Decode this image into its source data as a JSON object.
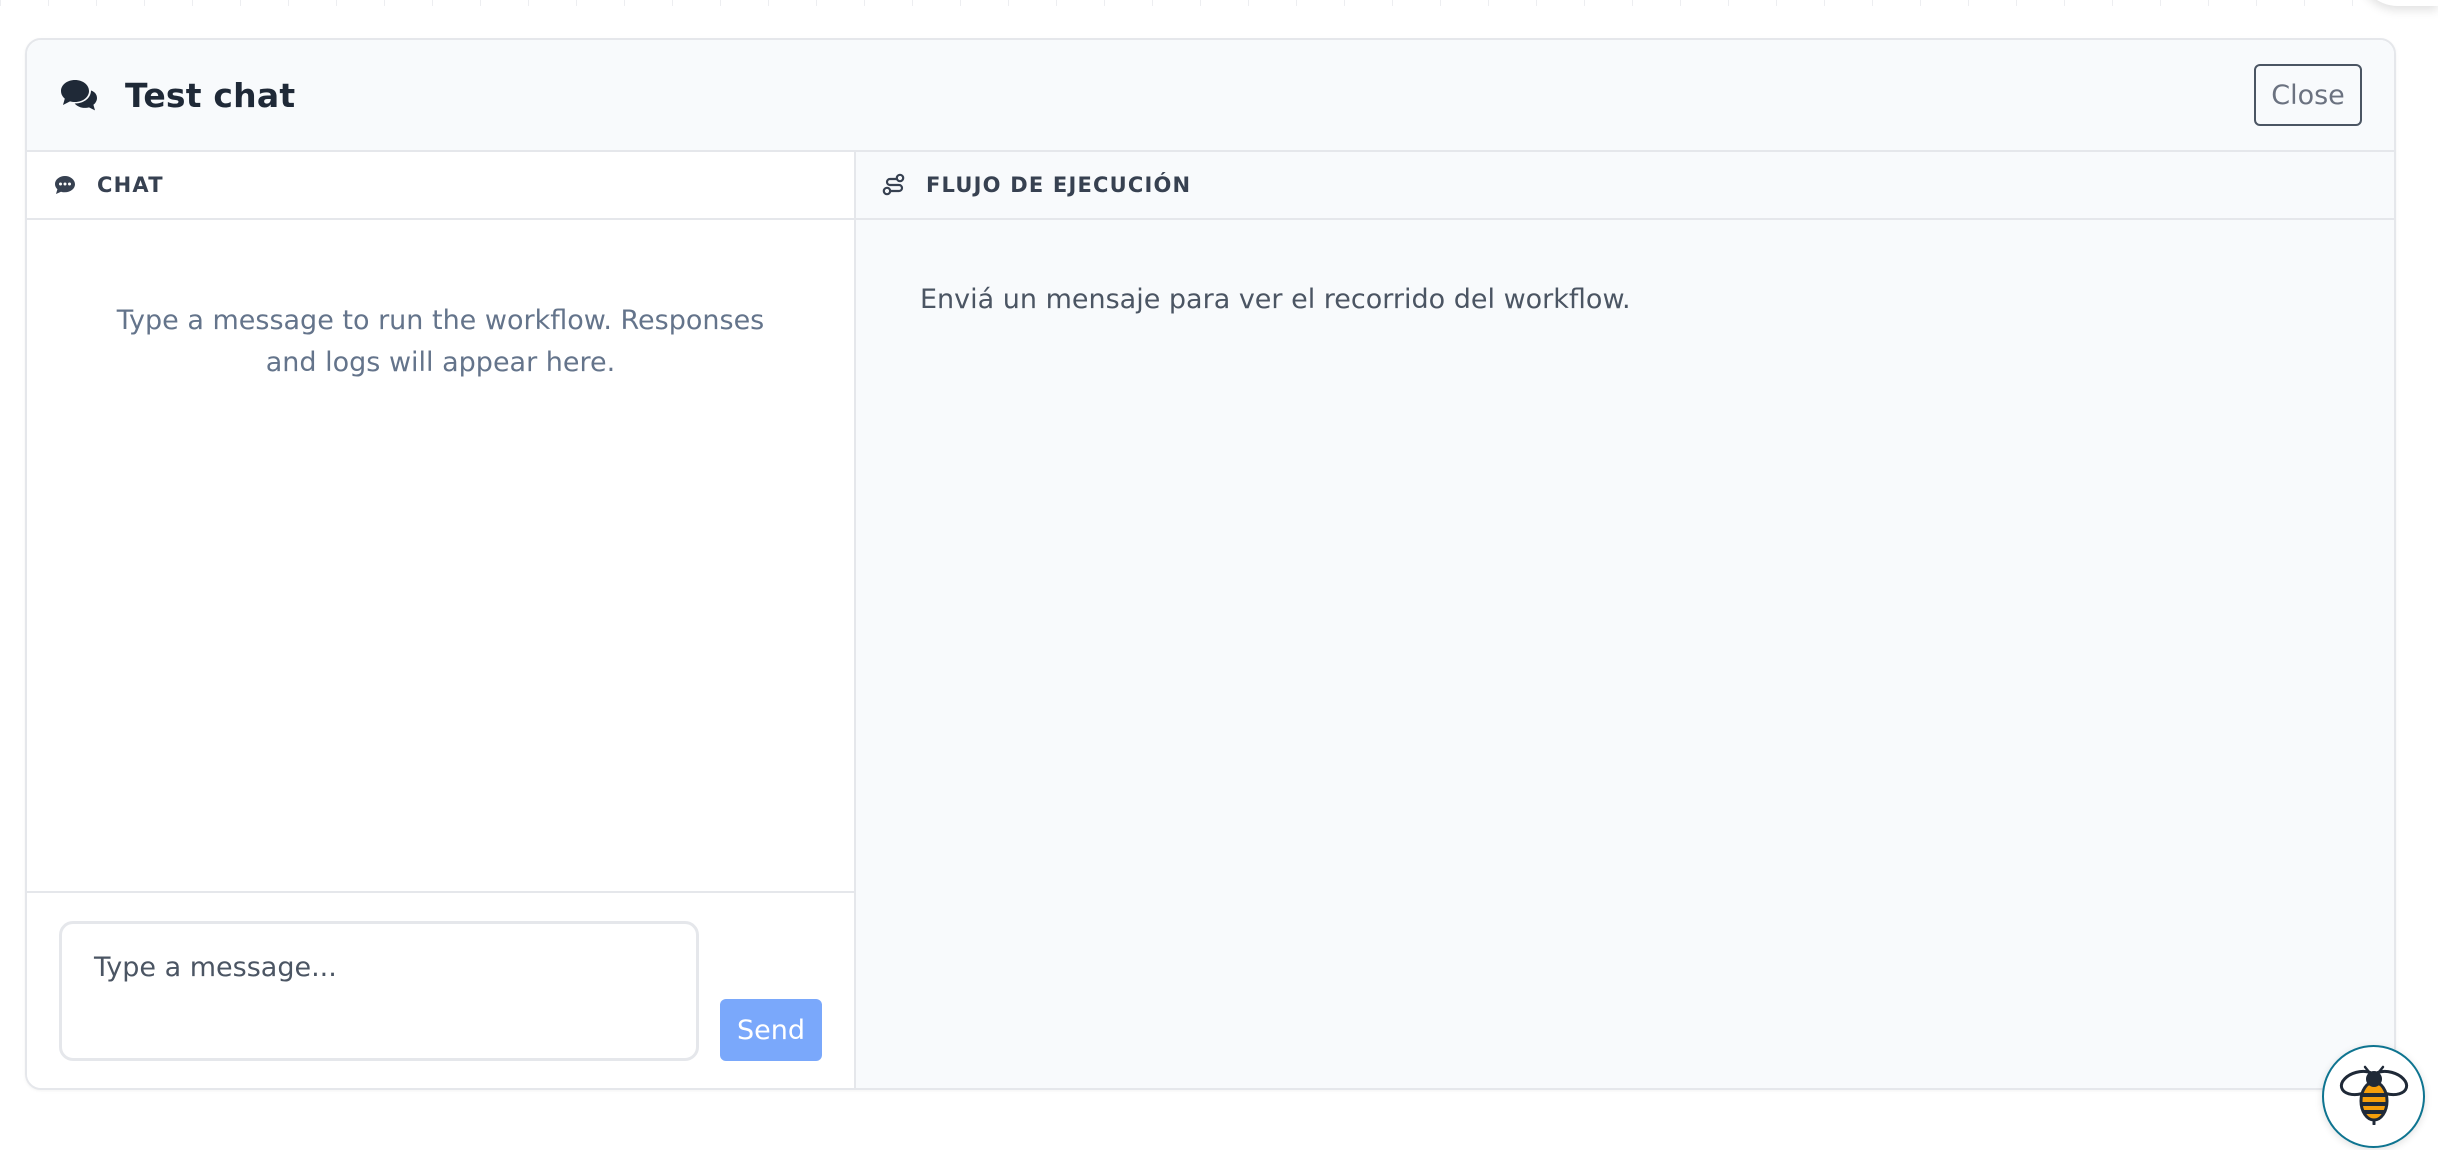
{
  "dialog": {
    "title": "Test chat",
    "close_label": "Close"
  },
  "chat": {
    "header_label": "CHAT",
    "empty_message": "Type a message to run the workflow. Responses and logs will appear here.",
    "input_placeholder": "Type a message...",
    "input_value": "",
    "send_label": "Send"
  },
  "flow": {
    "header_label": "FLUJO DE EJECUCIÓN",
    "empty_message": "Enviá un mensaje para ver el recorrido del workflow."
  },
  "icons": {
    "title": "chat-bubbles-icon",
    "chat": "comment-dots-icon",
    "flow": "route-icon",
    "assistant": "bee-icon"
  },
  "colors": {
    "accent": "#7aa8fb",
    "header_bg": "#f8fafc",
    "border": "#e5e7eb"
  }
}
